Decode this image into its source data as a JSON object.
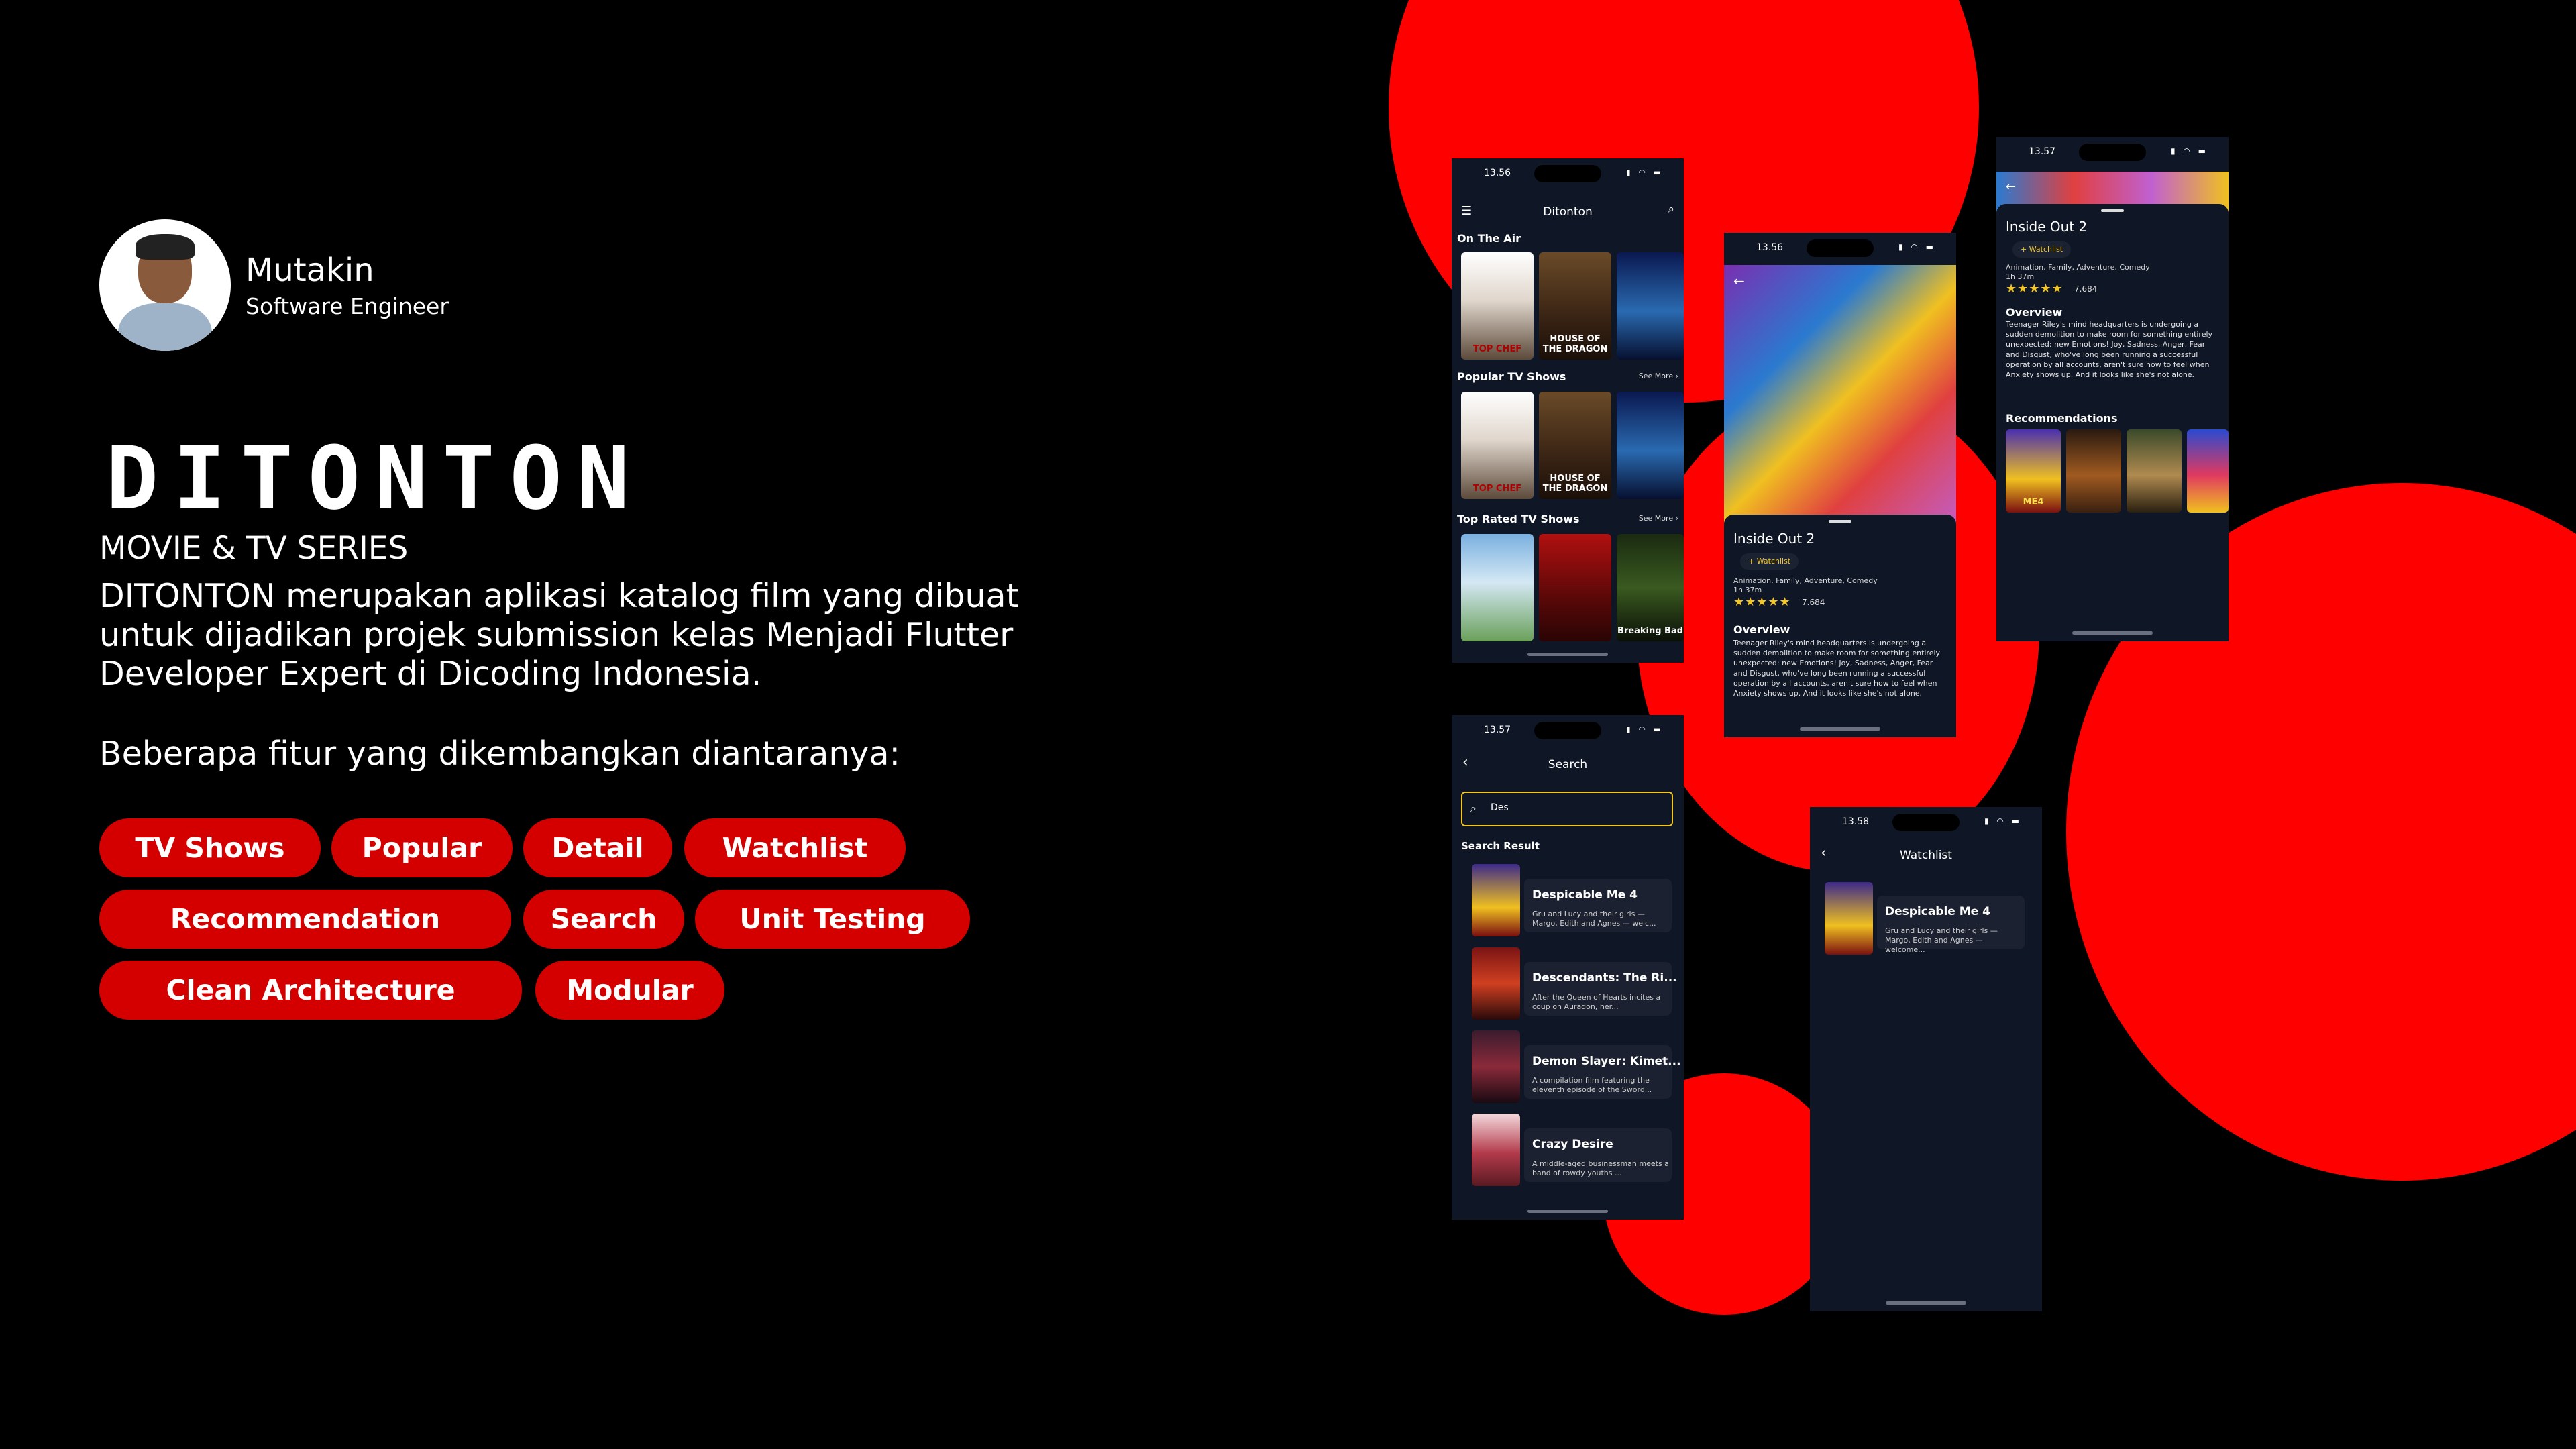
{
  "profile": {
    "name": "Mutakin",
    "role": "Software Engineer"
  },
  "app_logo": "DITONTON",
  "tagline": "MOVIE & TV SERIES",
  "description": "DITONTON merupakan aplikasi katalog film yang dibuat untuk dijadikan projek submission kelas Menjadi Flutter Developer Expert di Dicoding Indonesia.",
  "features_intro": "Beberapa fitur yang dikembangkan diantaranya:",
  "features": [
    "TV Shows",
    "Popular",
    "Detail",
    "Watchlist",
    "Recommendation",
    "Search",
    "Unit Testing",
    "Clean Architecture",
    "Modular"
  ],
  "colors": {
    "accent": "#ff0000",
    "chip": "#d40000",
    "phone_bg": "#0f1626",
    "star": "#f3c623"
  },
  "phone_home": {
    "time": "13.56",
    "title": "Ditonton",
    "sections": [
      {
        "label": "On The Air",
        "see_more": ""
      },
      {
        "label": "Popular TV Shows",
        "see_more": "See More"
      },
      {
        "label": "Top Rated TV Shows",
        "see_more": "See More"
      }
    ],
    "posters": [
      "TOP CHEF",
      "HOUSE OF THE DRAGON",
      "",
      "TOP CHEF",
      "HOUSE OF THE DRAGON",
      "",
      "",
      "",
      "Breaking Bad"
    ]
  },
  "phone_detail": {
    "time": "13.56",
    "title": "Inside Out 2",
    "watchlist": "Watchlist",
    "genres": "Animation, Family, Adventure, Comedy",
    "runtime": "1h 37m",
    "stars": "★★★★★",
    "rating": "7.684",
    "overview_label": "Overview",
    "overview": "Teenager Riley's mind headquarters is undergoing a sudden demolition to make room for something entirely unexpected: new Emotions! Joy, Sadness, Anger, Fear and Disgust, who've long been running a successful operation by all accounts, aren't sure how to feel when Anxiety shows up. And it looks like she's not alone."
  },
  "phone_detail_scrolled": {
    "time": "13.57",
    "title": "Inside Out 2",
    "watchlist": "Watchlist",
    "genres": "Animation, Family, Adventure, Comedy",
    "runtime": "1h 37m",
    "stars": "★★★★★",
    "rating": "7.684",
    "overview_label": "Overview",
    "overview": "Teenager Riley's mind headquarters is undergoing a sudden demolition to make room for something entirely unexpected: new Emotions! Joy, Sadness, Anger, Fear and Disgust, who've long been running a successful operation by all accounts, aren't sure how to feel when Anxiety shows up. And it looks like she's not alone.",
    "recommendations_label": "Recommendations",
    "recommendations": [
      "ME4",
      "",
      "",
      ""
    ]
  },
  "phone_search": {
    "time": "13.57",
    "title": "Search",
    "query": "Des",
    "result_label": "Search Result",
    "results": [
      {
        "title": "Despicable Me 4",
        "text": "Gru and Lucy and their girls — Margo, Edith and Agnes — welc...",
        "color": "#3d2a8a"
      },
      {
        "title": "Descendants: The Ri...",
        "text": "After the Queen of Hearts incites a coup on Auradon, her...",
        "color": "#7a1414"
      },
      {
        "title": "Demon Slayer: Kimet...",
        "text": "A compilation film featuring the eleventh episode of the Sword...",
        "color": "#3a1c2e"
      },
      {
        "title": "Crazy Desire",
        "text": "A middle-aged businessman meets a band of rowdy youths ...",
        "color": "#b23a4a"
      }
    ]
  },
  "phone_watchlist": {
    "time": "13.58",
    "title": "Watchlist",
    "item": {
      "title": "Despicable Me 4",
      "text": "Gru and Lucy and their girls — Margo, Edith and Agnes — welcome..."
    }
  }
}
